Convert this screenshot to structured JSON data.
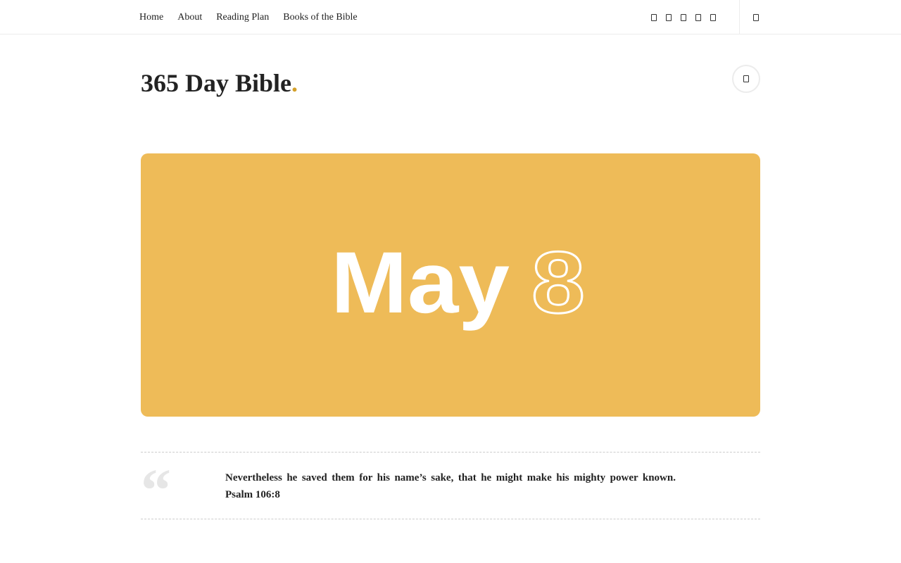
{
  "nav": {
    "items": [
      {
        "label": "Home"
      },
      {
        "label": "About"
      },
      {
        "label": "Reading Plan"
      },
      {
        "label": "Books of the Bible"
      }
    ]
  },
  "social_icons": [
    "social-icon-1",
    "social-icon-2",
    "social-icon-3",
    "social-icon-4",
    "social-icon-5"
  ],
  "header": {
    "site_title": "365 Day Bible",
    "title_dot": ".",
    "accent_color": "#d4a02a"
  },
  "hero": {
    "month_text": "May",
    "day_text": "8",
    "background_color": "#eebb58"
  },
  "quote": {
    "mark": "“",
    "text": "Nevertheless he saved them for his name’s sake, that he might make his mighty power known.",
    "reference": "Psalm 106:8"
  }
}
